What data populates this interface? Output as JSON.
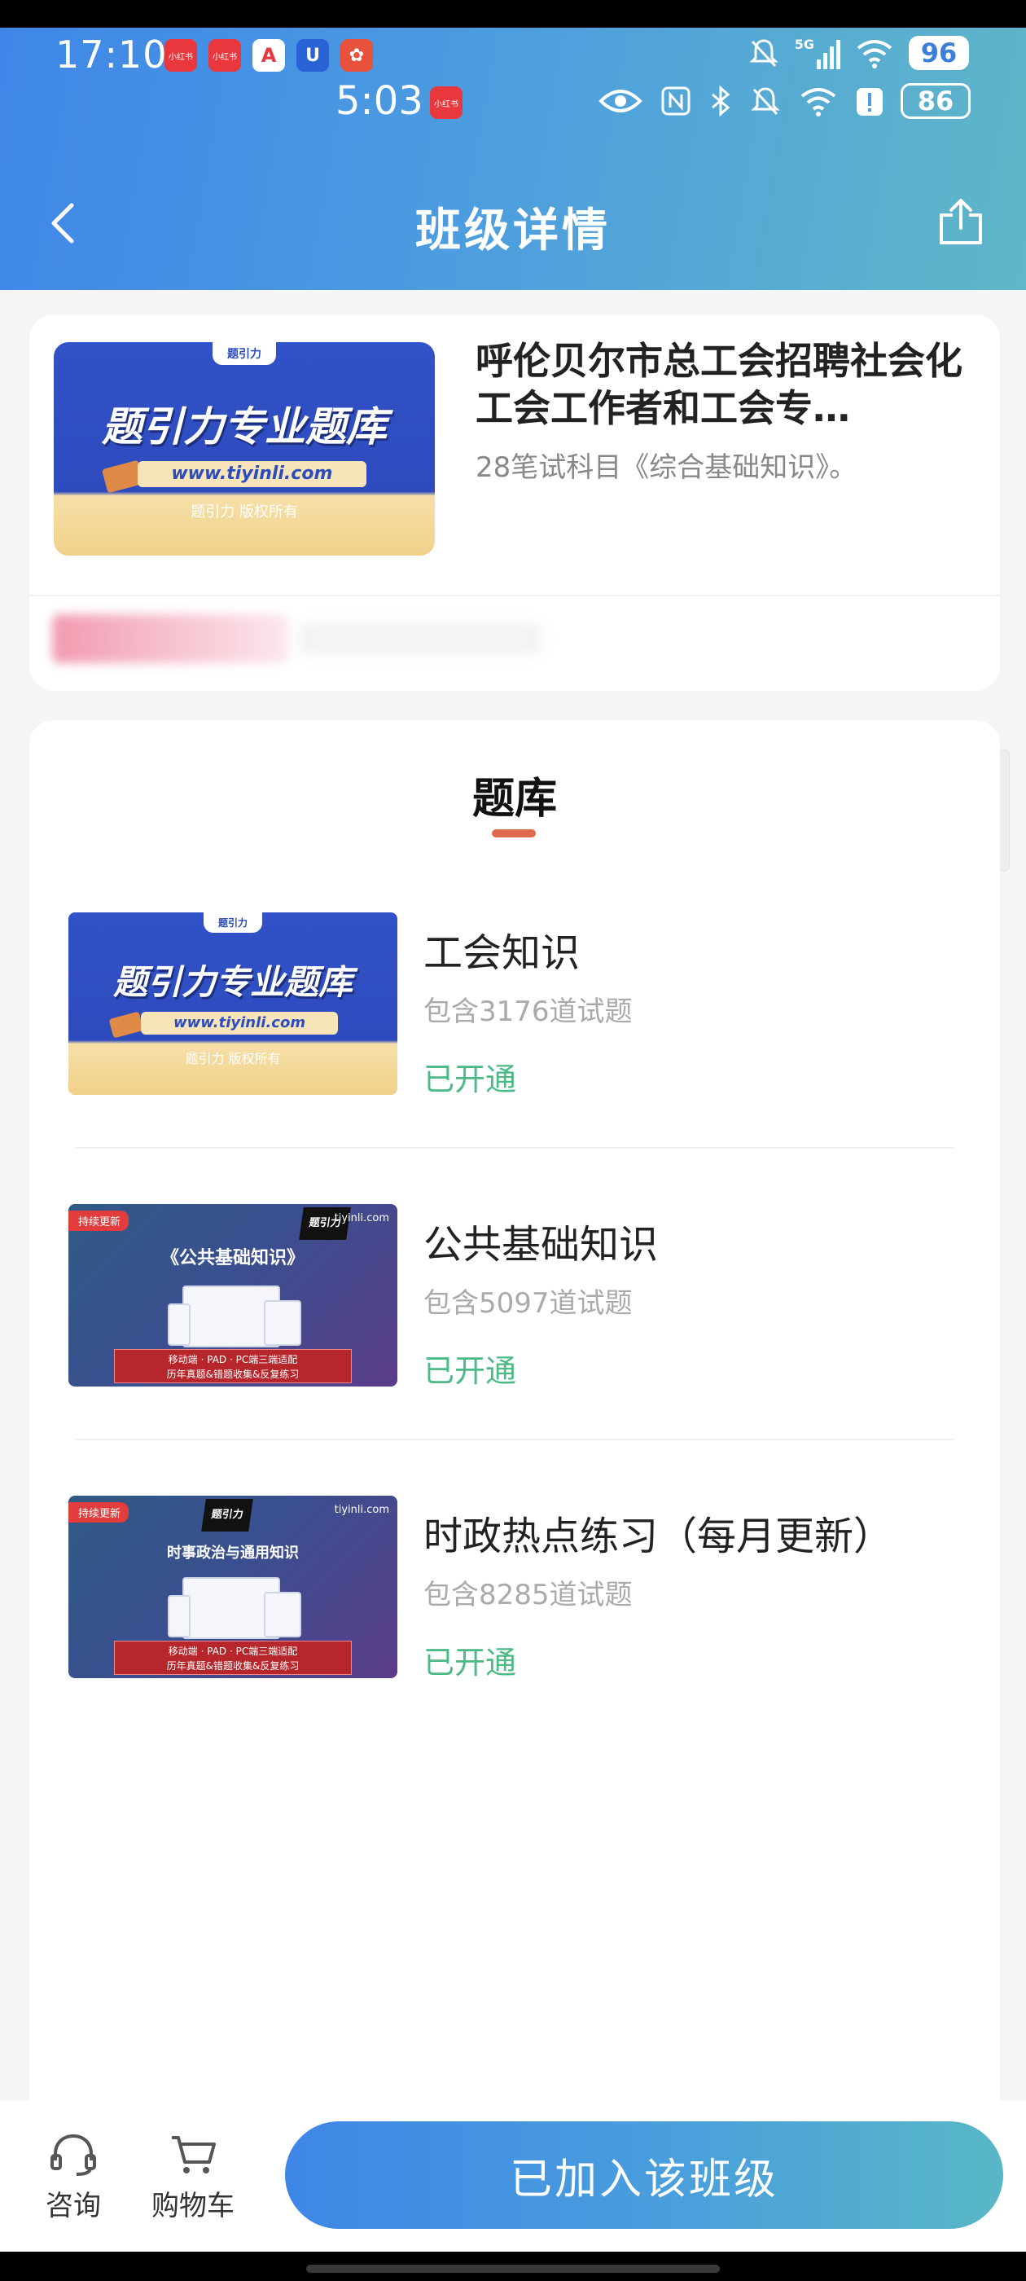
{
  "status_bar_outer": {
    "time": "17:10",
    "signal": "5G",
    "battery": "96",
    "app_icons": [
      "小红书",
      "小红书",
      "A",
      "U",
      "✿"
    ]
  },
  "status_bar_inner": {
    "time": "5:03",
    "app_icon": "小红书",
    "battery": "86"
  },
  "nav": {
    "title": "班级详情",
    "back_icon": "chevron-left-icon",
    "share_icon": "share-icon"
  },
  "class_info": {
    "title": "呼伦贝尔市总工会招聘社会化工会工作者和工会专…",
    "subtitle": "28笔试科目《综合基础知识》。",
    "cover": {
      "tag": "题引力",
      "headline": "题引力专业题库",
      "url": "www.tiyinli.com",
      "copyright": "题引力 版权所有"
    }
  },
  "question_bank": {
    "section_title": "题库",
    "items": [
      {
        "name": "工会知识",
        "count": "包含3176道试题",
        "status": "已开通",
        "thumb": {
          "tag": "题引力",
          "headline": "题引力专业题库",
          "url": "www.tiyinli.com",
          "copyright": "题引力 版权所有"
        }
      },
      {
        "name": "公共基础知识",
        "count": "包含5097道试题",
        "status": "已开通",
        "thumb": {
          "badge": "持续更新",
          "logo": "题引力",
          "site": "tiyinli.com",
          "headline": "《公共基础知识》",
          "bar_line1": "移动端 · PAD · PC端三端适配",
          "bar_line2": "历年真题&错题收集&反复练习"
        }
      },
      {
        "name": "时政热点练习（每月更新）",
        "count": "包含8285道试题",
        "status": "已开通",
        "thumb": {
          "badge": "持续更新",
          "logo": "题引力",
          "site": "tiyinli.com",
          "headline": "时事政治与通用知识",
          "bar_line1": "移动端 · PAD · PC端三端适配",
          "bar_line2": "历年真题&错题收集&反复练习"
        }
      }
    ]
  },
  "bottom_bar": {
    "consult_label": "咨询",
    "cart_label": "购物车",
    "join_label": "已加入该班级"
  },
  "colors": {
    "header_start": "#3f86e8",
    "header_end": "#5fb7c7",
    "status_green": "#4cba85",
    "accent_underline": "#e06a4b"
  }
}
